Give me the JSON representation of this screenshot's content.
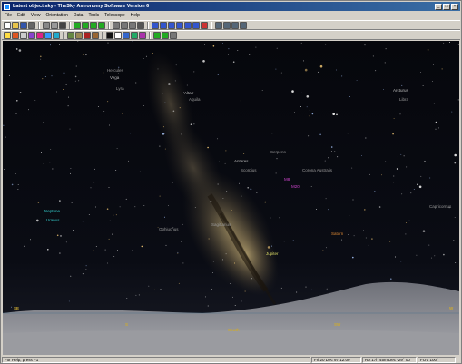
{
  "window": {
    "title": "Latest object.sky - TheSky Astronomy Software Version 6",
    "minimize": "_",
    "maximize": "□",
    "close": "×"
  },
  "menu": [
    "File",
    "Edit",
    "View",
    "Orientation",
    "Data",
    "Tools",
    "Telescope",
    "Help"
  ],
  "toolbar1": [
    {
      "icon": "new-file-icon",
      "color": "#ffffff"
    },
    {
      "icon": "open-folder-icon",
      "color": "#e8c34a"
    },
    {
      "icon": "save-icon",
      "color": "#3355aa"
    },
    {
      "icon": "print-icon",
      "color": "#666666"
    },
    {
      "sep": true
    },
    {
      "icon": "cut-icon",
      "color": "#888888"
    },
    {
      "icon": "copy-icon",
      "color": "#999999"
    },
    {
      "icon": "find-icon",
      "color": "#444444"
    },
    {
      "sep": true
    },
    {
      "icon": "arrow-left-icon",
      "color": "#22aa22"
    },
    {
      "icon": "arrow-up-icon",
      "color": "#22aa22"
    },
    {
      "icon": "arrow-down-icon",
      "color": "#22aa22"
    },
    {
      "icon": "arrow-right-icon",
      "color": "#22aa22"
    },
    {
      "sep": true
    },
    {
      "icon": "zoom-in-icon",
      "color": "#777777"
    },
    {
      "icon": "zoom-out-icon",
      "color": "#777777"
    },
    {
      "icon": "field-of-view-icon",
      "color": "#777777"
    },
    {
      "icon": "telescope-icon",
      "color": "#555555"
    },
    {
      "sep": true
    },
    {
      "icon": "time-step-icon",
      "color": "#3355cc"
    },
    {
      "icon": "animate-icon",
      "color": "#3355cc"
    },
    {
      "icon": "reverse-icon",
      "color": "#3355cc"
    },
    {
      "icon": "forward-icon",
      "color": "#3355cc"
    },
    {
      "icon": "step-back-icon",
      "color": "#3355cc"
    },
    {
      "icon": "step-forward-icon",
      "color": "#3355cc"
    },
    {
      "icon": "stop-icon",
      "color": "#cc3333"
    },
    {
      "sep": true
    },
    {
      "icon": "horizon-icon",
      "color": "#556677"
    },
    {
      "icon": "grid-icon",
      "color": "#556677"
    },
    {
      "icon": "constellation-icon",
      "color": "#556677"
    },
    {
      "icon": "label-icon",
      "color": "#556677"
    }
  ],
  "toolbar2": [
    {
      "icon": "stars-icon",
      "color": "#ffdd44"
    },
    {
      "icon": "planets-icon",
      "color": "#dd5522"
    },
    {
      "icon": "moon-icon",
      "color": "#cccccc"
    },
    {
      "icon": "galaxy-icon",
      "color": "#8844cc"
    },
    {
      "icon": "nebula-icon",
      "color": "#dd2288"
    },
    {
      "icon": "cluster-icon",
      "color": "#3399ff"
    },
    {
      "icon": "comet-icon",
      "color": "#22aacc"
    },
    {
      "sep": true
    },
    {
      "icon": "mountain-icon",
      "color": "#668844"
    },
    {
      "icon": "photo-icon",
      "color": "#998855"
    },
    {
      "icon": "satellite-icon",
      "color": "#aa2222"
    },
    {
      "icon": "asteroid-icon",
      "color": "#996633"
    },
    {
      "sep": true
    },
    {
      "icon": "chart-icon",
      "color": "#111111"
    },
    {
      "icon": "eyepiece-icon",
      "color": "#ffffff"
    },
    {
      "icon": "ccd-frame-icon",
      "color": "#3366cc"
    },
    {
      "icon": "orbit-icon",
      "color": "#22aa66"
    },
    {
      "icon": "observe-icon",
      "color": "#aa33aa"
    },
    {
      "sep": true
    },
    {
      "icon": "leaf-icon",
      "color": "#22aa22"
    },
    {
      "icon": "check-icon",
      "color": "#22aa22"
    },
    {
      "icon": "link-icon",
      "color": "#777777"
    }
  ],
  "sky": {
    "horizon_labels": [
      {
        "text": "SE",
        "color": "#ccaa33"
      },
      {
        "text": "S",
        "color": "#ccaa33"
      },
      {
        "text": "South",
        "color": "#ccaa33"
      },
      {
        "text": "SW",
        "color": "#ccaa33"
      },
      {
        "text": "W",
        "color": "#ccaa33"
      }
    ],
    "objects": [
      {
        "name": "Hercules",
        "color": "#999999"
      },
      {
        "name": "Vega",
        "color": "#bbbbbb"
      },
      {
        "name": "Lyra",
        "color": "#999999"
      },
      {
        "name": "Altair",
        "color": "#bbbbbb"
      },
      {
        "name": "Aquila",
        "color": "#999999"
      },
      {
        "name": "Antares",
        "color": "#bbbbbb"
      },
      {
        "name": "Scorpius",
        "color": "#999999"
      },
      {
        "name": "Sagittarius",
        "color": "#999999"
      },
      {
        "name": "Jupiter",
        "color": "#dddd66"
      },
      {
        "name": "Neptune",
        "color": "#33cccc"
      },
      {
        "name": "Uranus",
        "color": "#33cccc"
      },
      {
        "name": "Saturn",
        "color": "#dd8833"
      },
      {
        "name": "Ophiuchus",
        "color": "#999999"
      },
      {
        "name": "Serpens",
        "color": "#999999"
      },
      {
        "name": "Corona Australis",
        "color": "#999999"
      },
      {
        "name": "M8",
        "color": "#cc44cc"
      },
      {
        "name": "M20",
        "color": "#cc44cc"
      },
      {
        "name": "Arcturus",
        "color": "#bbbbbb"
      },
      {
        "name": "Libra",
        "color": "#999999"
      },
      {
        "name": "Capricornus",
        "color": "#999999"
      }
    ]
  },
  "status": {
    "left": "For Help, press F1",
    "date": "Fri 20 Dec 97 12:00",
    "coords": "RA 17h 45m  Dec -29° 00'",
    "fov": "FOV 100°"
  }
}
